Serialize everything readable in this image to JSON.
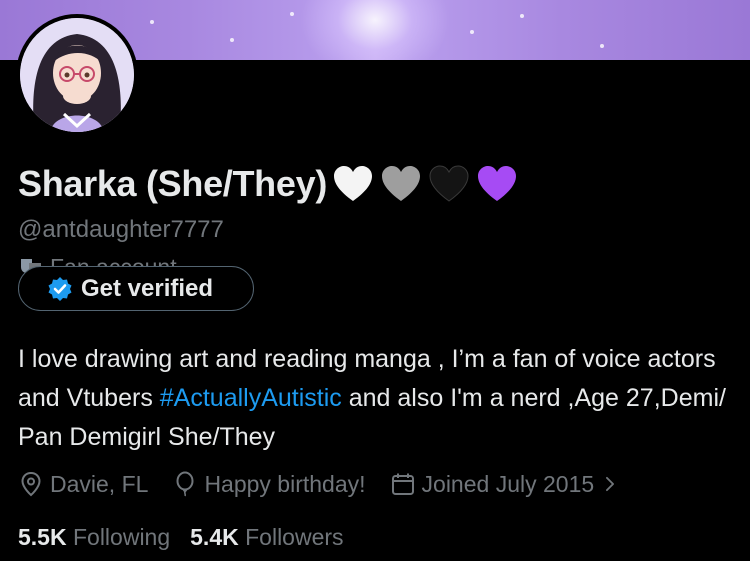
{
  "profile": {
    "name": "Sharka (She/They)",
    "handle": "@antdaughter7777",
    "category": "Fan account",
    "hearts": [
      "white-heart",
      "grey-heart",
      "black-heart",
      "purple-heart"
    ],
    "verify_label": "Get verified",
    "bio": {
      "before": "I love drawing art and reading manga , I’m a fan of voice actors and Vtubers ",
      "hashtag": "#ActuallyAutistic",
      "after": " and also I'm a nerd ,Age 27,Demi/ Pan Demigirl She/They"
    },
    "location": "Davie, FL",
    "birthday": "Happy birthday!",
    "joined": "Joined July 2015",
    "following_count": "5.5K",
    "following_label": "Following",
    "followers_count": "5.4K",
    "followers_label": "Followers"
  },
  "colors": {
    "background": "#000000",
    "text": "#e7e9ea",
    "secondary": "#71767b",
    "link": "#1d9bf0",
    "banner": "#a888e0",
    "purple_heart": "#a64bf4"
  }
}
